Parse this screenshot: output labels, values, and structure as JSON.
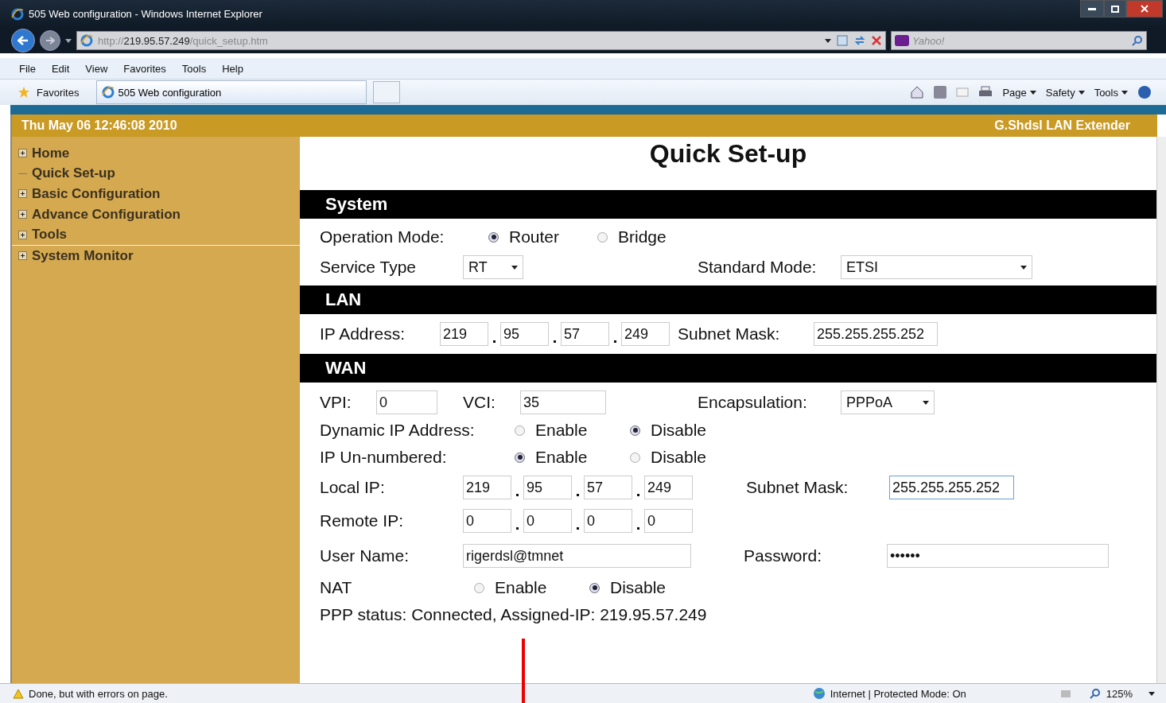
{
  "window": {
    "title": "505 Web configuration - Windows Internet Explorer"
  },
  "address_bar": {
    "url_prefix": "http://",
    "url_host": "219.95.57.249",
    "url_path": "/quick_setup.htm"
  },
  "search": {
    "placeholder": "Yahoo!"
  },
  "menu": [
    "File",
    "Edit",
    "View",
    "Favorites",
    "Tools",
    "Help"
  ],
  "favorites_bar": {
    "favorites": "Favorites",
    "tab": "505 Web configuration",
    "commands": [
      "Page",
      "Safety",
      "Tools"
    ]
  },
  "page": {
    "date": "Thu May 06 12:46:08 2010",
    "product": "G.Shdsl LAN Extender",
    "title": "Quick Set-up"
  },
  "sidebar": {
    "items": [
      {
        "label": "Home",
        "expandable": true
      },
      {
        "label": "Quick Set-up",
        "expandable": false
      },
      {
        "label": "Basic Configuration",
        "expandable": true
      },
      {
        "label": "Advance Configuration",
        "expandable": true
      },
      {
        "label": "Tools",
        "expandable": true
      },
      {
        "label": "System Monitor",
        "expandable": true
      }
    ]
  },
  "system": {
    "heading": "System",
    "operation_mode": {
      "label": "Operation Mode:",
      "options": [
        {
          "label": "Router",
          "selected": true
        },
        {
          "label": "Bridge",
          "selected": false
        }
      ]
    },
    "service_type": {
      "label": "Service Type",
      "value": "RT"
    },
    "standard_mode": {
      "label": "Standard Mode:",
      "value": "ETSI"
    }
  },
  "lan": {
    "heading": "LAN",
    "ip_address": {
      "label": "IP Address:",
      "octets": [
        "219",
        "95",
        "57",
        "249"
      ]
    },
    "subnet_mask": {
      "label": "Subnet Mask:",
      "value": "255.255.255.252"
    }
  },
  "wan": {
    "heading": "WAN",
    "vpi": {
      "label": "VPI:",
      "value": "0"
    },
    "vci": {
      "label": "VCI:",
      "value": "35"
    },
    "encapsulation": {
      "label": "Encapsulation:",
      "value": "PPPoA"
    },
    "dynamic_ip": {
      "label": "Dynamic IP Address:",
      "options": [
        {
          "label": "Enable",
          "selected": false
        },
        {
          "label": "Disable",
          "selected": true
        }
      ]
    },
    "ip_unnumbered": {
      "label": "IP Un-numbered:",
      "options": [
        {
          "label": "Enable",
          "selected": true
        },
        {
          "label": "Disable",
          "selected": false
        }
      ]
    },
    "local_ip": {
      "label": "Local IP:",
      "octets": [
        "219",
        "95",
        "57",
        "249"
      ]
    },
    "subnet_mask": {
      "label": "Subnet Mask:",
      "value": "255.255.255.252"
    },
    "remote_ip": {
      "label": "Remote IP:",
      "octets": [
        "0",
        "0",
        "0",
        "0"
      ]
    },
    "user_name": {
      "label": "User Name:",
      "value": "rigerdsl@tmnet"
    },
    "password": {
      "label": "Password:",
      "value": "••••••"
    },
    "nat": {
      "label": "NAT",
      "options": [
        {
          "label": "Enable",
          "selected": false
        },
        {
          "label": "Disable",
          "selected": true
        }
      ]
    },
    "ppp_status": "PPP status: Connected, Assigned-IP: 219.95.57.249"
  },
  "status_bar": {
    "message": "Done, but with errors on page.",
    "zone": "Internet | Protected Mode: On",
    "zoom": "125%"
  }
}
